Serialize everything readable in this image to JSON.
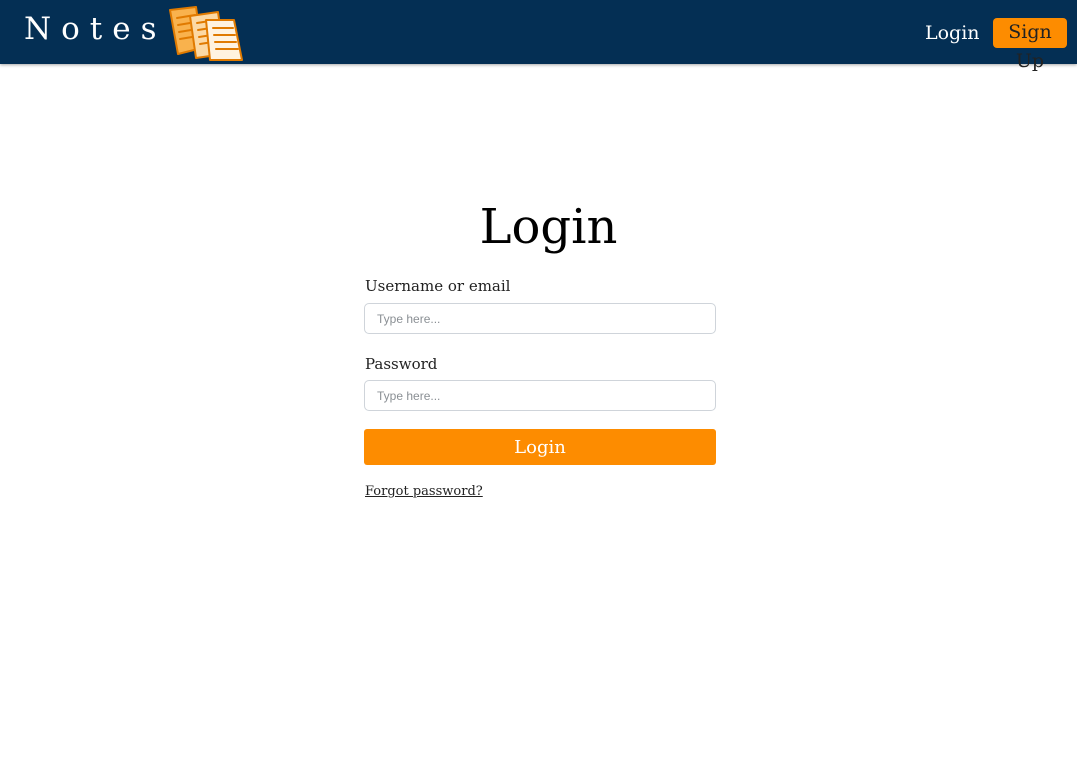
{
  "header": {
    "brand": "Notes",
    "logo_icon": "notebook-icon",
    "nav": {
      "login_label": "Login",
      "signup_label": "Sign Up"
    }
  },
  "main": {
    "title": "Login",
    "form": {
      "username": {
        "label": "Username or email",
        "placeholder": "Type here...",
        "value": ""
      },
      "password": {
        "label": "Password",
        "placeholder": "Type here...",
        "value": ""
      },
      "submit_label": "Login",
      "forgot_link": "Forgot password?"
    }
  },
  "colors": {
    "navbar": "#042f54",
    "accent": "#fd8c00",
    "background": "#ffffff"
  }
}
